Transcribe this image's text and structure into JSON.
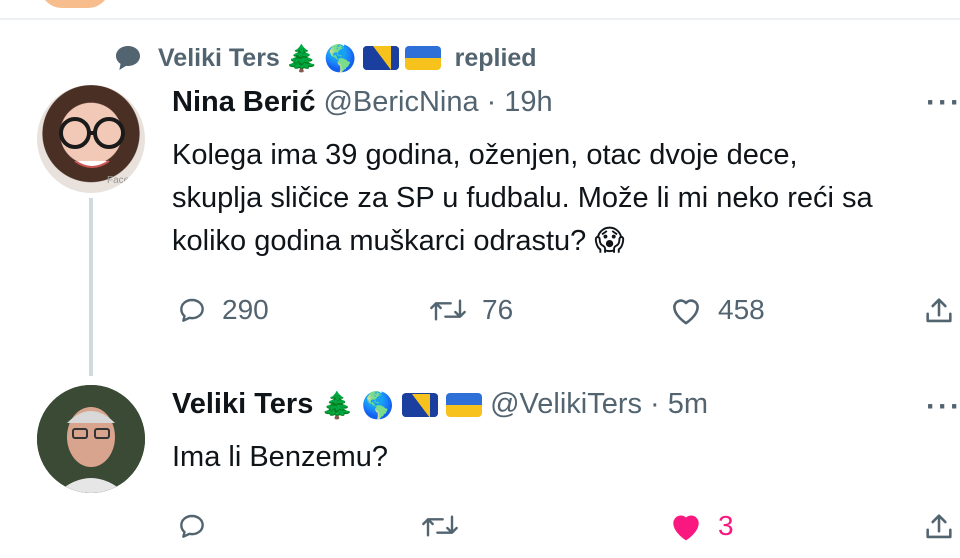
{
  "social_context": {
    "name": "Veliki Ters",
    "emojis": [
      "🌲",
      "🌎"
    ],
    "label": "replied"
  },
  "tweet1": {
    "author_name": "Nina Berić",
    "handle": "@BericNina",
    "separator": "·",
    "time": "19h",
    "text": "Kolega ima 39 godina, oženjen, otac dvoje dece,\nskuplja sličice za SP u fudbalu. Može li mi neko reći sa\nkoliko godina muškarci odrastu? 😱",
    "reply_count": "290",
    "retweet_count": "76",
    "like_count": "458",
    "avatar_watermark": "Face"
  },
  "tweet2": {
    "author_name": "Veliki Ters",
    "emojis": [
      "🌲",
      "🌎"
    ],
    "handle": "@VelikiTers",
    "separator": "·",
    "time": "5m",
    "text": "Ima li Benzemu?",
    "like_count": "3",
    "liked": true
  },
  "colors": {
    "muted": "#536471",
    "like_active": "#f91880",
    "thread_line": "#cfd9de"
  }
}
